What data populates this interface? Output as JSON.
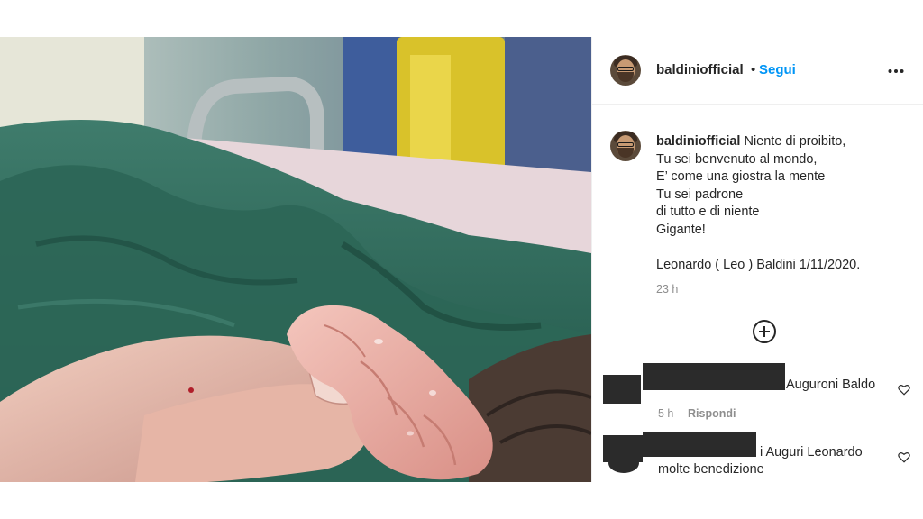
{
  "post": {
    "username": "baldiniofficial",
    "separator": "•",
    "follow_label": "Segui",
    "more_label": "•••"
  },
  "caption": {
    "username": "baldiniofficial",
    "lines": [
      "Niente di proibito,",
      "Tu sei benvenuto al mondo,",
      "E’ come una giostra la mente",
      "Tu sei padrone",
      "di tutto e di niente",
      "Gigante!",
      "",
      "Leonardo ( Leo ) Baldini 1/11/2020."
    ],
    "time": "23 h"
  },
  "comments": [
    {
      "text": "Auguroni Baldo",
      "time": "5 h",
      "reply_label": "Rispondi"
    },
    {
      "text": "i Auguri Leonardo",
      "text_line2": "molte benedizione"
    }
  ],
  "icons": {
    "load_more": "plus-circle-icon",
    "like": "heart-icon",
    "options": "more-horizontal-icon"
  },
  "colors": {
    "link_blue": "#0095f6",
    "secondary_text": "#8e8e8e",
    "scrub_green": "#2f6a5a"
  }
}
